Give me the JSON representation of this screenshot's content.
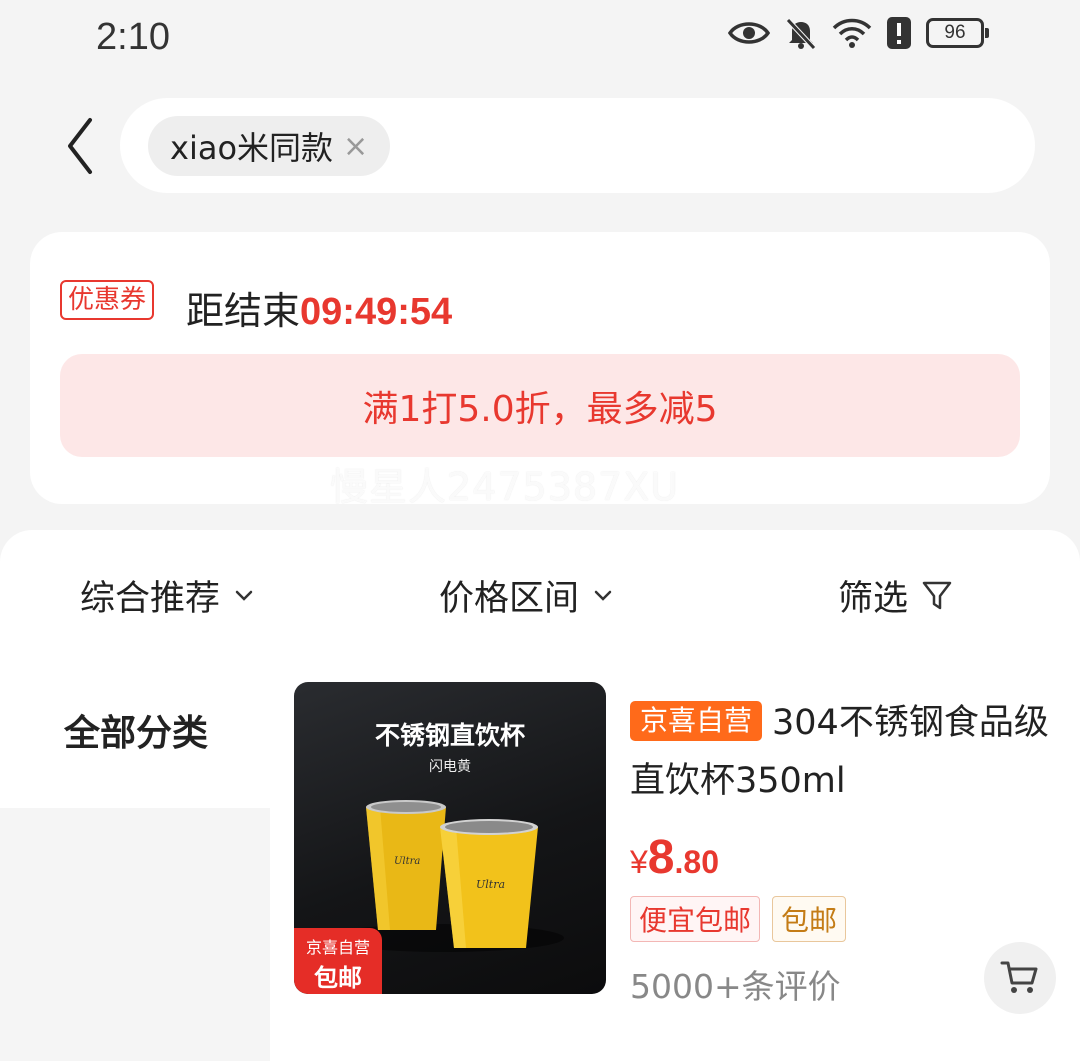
{
  "status_bar": {
    "time": "2:10",
    "battery": "96",
    "icons": [
      "eye-icon",
      "bell-mute-icon",
      "wifi-icon",
      "alert-icon",
      "battery-icon"
    ]
  },
  "search": {
    "chip_text": "xiao米同款",
    "chip_close": "×"
  },
  "coupon": {
    "tag": "优惠券",
    "countdown_prefix": "距结束",
    "countdown_time": "09:49:54",
    "offer": "满1打5.0折，最多减5",
    "watermark": "慢星人2475387XU"
  },
  "filters": [
    {
      "label": "综合推荐",
      "icon": "chevron-down-icon"
    },
    {
      "label": "价格区间",
      "icon": "chevron-down-icon"
    },
    {
      "label": "筛选",
      "icon": "filter-icon"
    }
  ],
  "sidebar": {
    "active": "全部分类"
  },
  "product": {
    "image_title": "不锈钢直饮杯",
    "image_subtitle": "闪电黄",
    "image_badge_top": "京喜自营",
    "image_badge_bottom": "包邮",
    "store_tag": "京喜自营",
    "title": "304不锈钢食品级直饮杯350ml",
    "price_symbol": "¥",
    "price_int": "8",
    "price_dec": ".80",
    "tag_1": "便宜包邮",
    "tag_2": "包邮",
    "reviews": "5000+条评价"
  },
  "colors": {
    "accent": "#e8382f",
    "store_tag": "#ff6a1a",
    "cup_yellow": "#f2c21b"
  }
}
